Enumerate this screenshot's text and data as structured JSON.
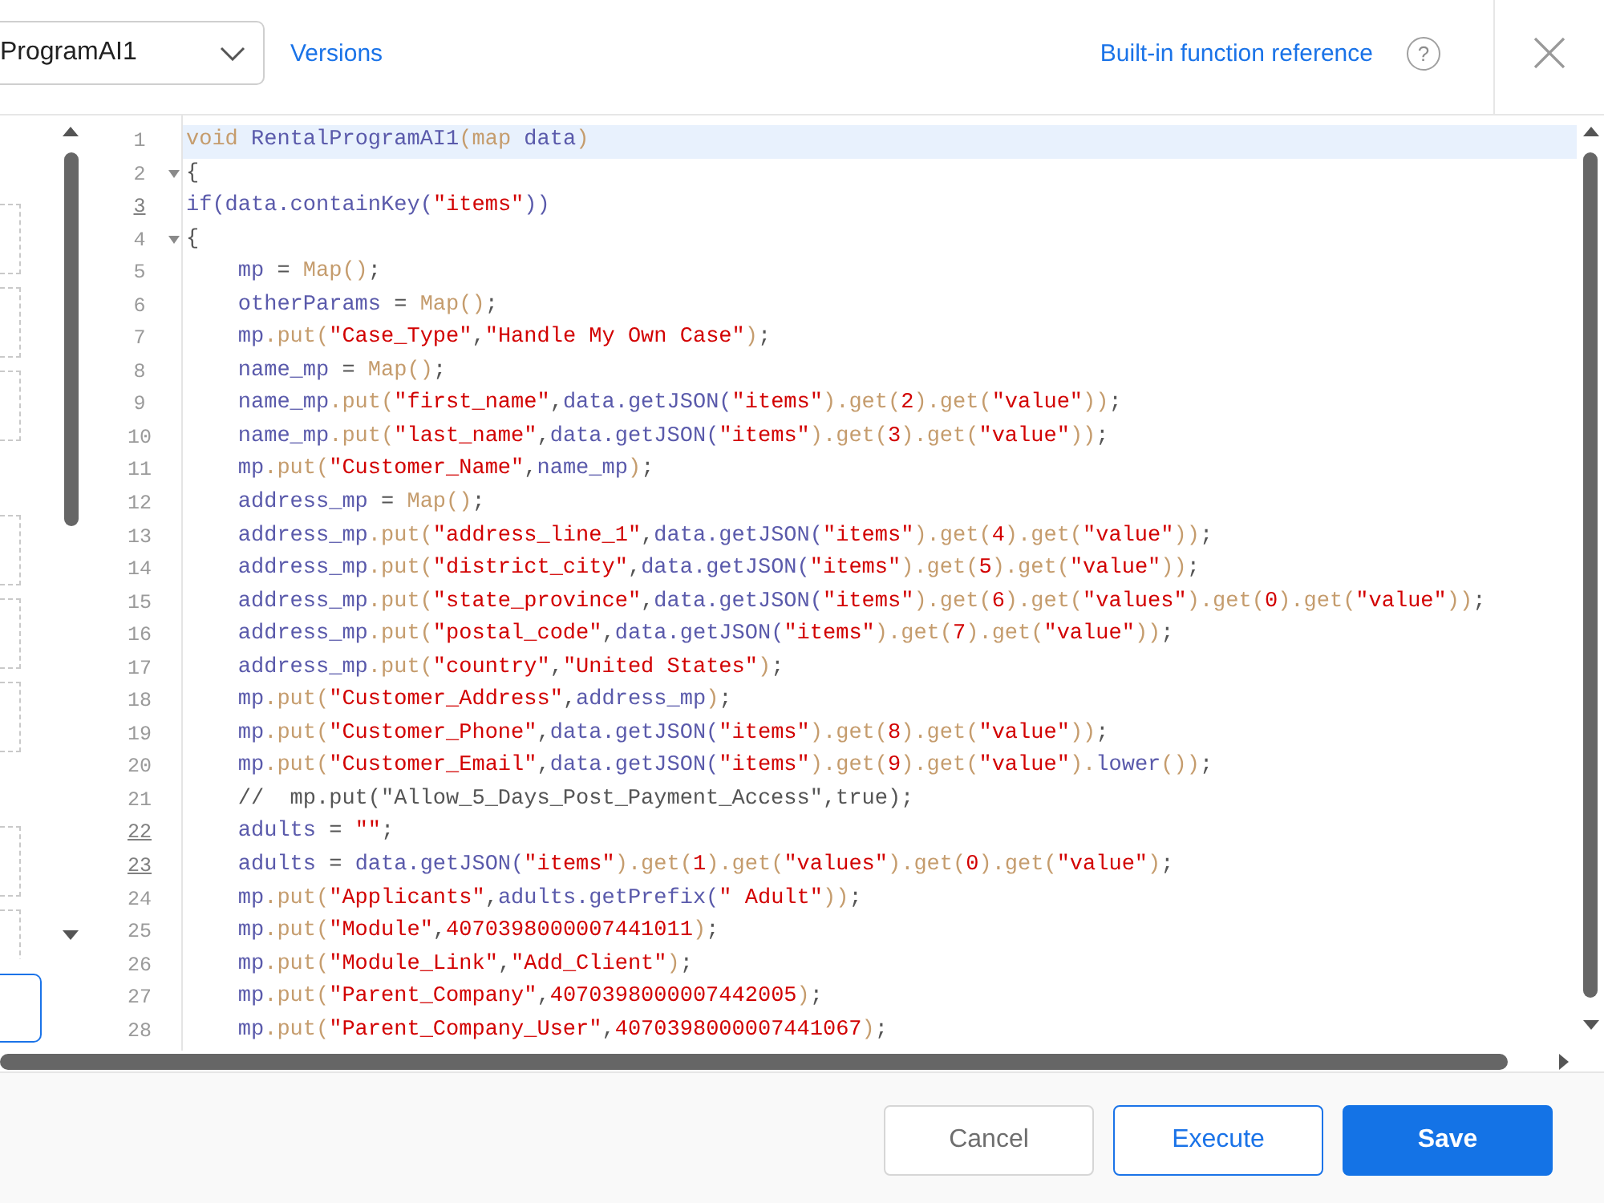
{
  "header": {
    "program_select": {
      "value": "ProgramAI1"
    },
    "versions_link": "Versions",
    "reference_link": "Built-in function reference",
    "help_label": "?"
  },
  "editor": {
    "lines": [
      {
        "number": "1",
        "current": true,
        "marked": false,
        "tokens": [
          {
            "kind": "builtin",
            "text": "void "
          },
          {
            "kind": "name",
            "text": "RentalProgramAI1"
          },
          {
            "kind": "builtin",
            "text": "(map "
          },
          {
            "kind": "name",
            "text": "data"
          },
          {
            "kind": "builtin",
            "text": ")"
          }
        ]
      },
      {
        "number": "2",
        "current": false,
        "marked": false,
        "expanded": true,
        "tokens": [
          {
            "kind": "plain",
            "text": "{"
          }
        ]
      },
      {
        "number": "3",
        "current": false,
        "marked": true,
        "tokens": [
          {
            "kind": "name",
            "text": "if(data.containKey("
          },
          {
            "kind": "literal",
            "text": "\"items\""
          },
          {
            "kind": "name",
            "text": "))"
          }
        ]
      },
      {
        "number": "4",
        "current": false,
        "marked": false,
        "expanded": true,
        "tokens": [
          {
            "kind": "plain",
            "text": "{"
          }
        ],
        "children": [
          {
            "number": "5",
            "current": false,
            "marked": false,
            "tokens": [
              {
                "kind": "name",
                "text": "mp"
              },
              {
                "kind": "plain",
                "text": " = "
              },
              {
                "kind": "builtin",
                "text": "Map()"
              },
              {
                "kind": "plain",
                "text": ";"
              }
            ]
          },
          {
            "number": "6",
            "current": false,
            "marked": false,
            "tokens": [
              {
                "kind": "name",
                "text": "otherParams"
              },
              {
                "kind": "plain",
                "text": " = "
              },
              {
                "kind": "builtin",
                "text": "Map()"
              },
              {
                "kind": "plain",
                "text": ";"
              }
            ]
          },
          {
            "number": "7",
            "current": false,
            "marked": false,
            "tokens": [
              {
                "kind": "name",
                "text": "mp"
              },
              {
                "kind": "builtin",
                "text": ".put("
              },
              {
                "kind": "literal",
                "text": "\"Case_Type\""
              },
              {
                "kind": "plain",
                "text": ","
              },
              {
                "kind": "literal",
                "text": "\"Handle My Own Case\""
              },
              {
                "kind": "builtin",
                "text": ")"
              },
              {
                "kind": "plain",
                "text": ";"
              }
            ]
          },
          {
            "number": "8",
            "current": false,
            "marked": false,
            "tokens": [
              {
                "kind": "name",
                "text": "name_mp"
              },
              {
                "kind": "plain",
                "text": " = "
              },
              {
                "kind": "builtin",
                "text": "Map()"
              },
              {
                "kind": "plain",
                "text": ";"
              }
            ]
          },
          {
            "number": "9",
            "current": false,
            "marked": false,
            "tokens": [
              {
                "kind": "name",
                "text": "name_mp"
              },
              {
                "kind": "builtin",
                "text": ".put("
              },
              {
                "kind": "literal",
                "text": "\"first_name\""
              },
              {
                "kind": "plain",
                "text": ","
              },
              {
                "kind": "name",
                "text": "data.getJSON("
              },
              {
                "kind": "literal",
                "text": "\"items\""
              },
              {
                "kind": "builtin",
                "text": ").get("
              },
              {
                "kind": "literal",
                "text": "2"
              },
              {
                "kind": "builtin",
                "text": ").get("
              },
              {
                "kind": "literal",
                "text": "\"value\""
              },
              {
                "kind": "builtin",
                "text": "))"
              },
              {
                "kind": "plain",
                "text": ";"
              }
            ]
          },
          {
            "number": "10",
            "current": false,
            "marked": false,
            "tokens": [
              {
                "kind": "name",
                "text": "name_mp"
              },
              {
                "kind": "builtin",
                "text": ".put("
              },
              {
                "kind": "literal",
                "text": "\"last_name\""
              },
              {
                "kind": "plain",
                "text": ","
              },
              {
                "kind": "name",
                "text": "data.getJSON("
              },
              {
                "kind": "literal",
                "text": "\"items\""
              },
              {
                "kind": "builtin",
                "text": ").get("
              },
              {
                "kind": "literal",
                "text": "3"
              },
              {
                "kind": "builtin",
                "text": ").get("
              },
              {
                "kind": "literal",
                "text": "\"value\""
              },
              {
                "kind": "builtin",
                "text": "))"
              },
              {
                "kind": "plain",
                "text": ";"
              }
            ]
          },
          {
            "number": "11",
            "current": false,
            "marked": false,
            "tokens": [
              {
                "kind": "name",
                "text": "mp"
              },
              {
                "kind": "builtin",
                "text": ".put("
              },
              {
                "kind": "literal",
                "text": "\"Customer_Name\""
              },
              {
                "kind": "plain",
                "text": ","
              },
              {
                "kind": "name",
                "text": "name_mp"
              },
              {
                "kind": "builtin",
                "text": ")"
              },
              {
                "kind": "plain",
                "text": ";"
              }
            ]
          },
          {
            "number": "12",
            "current": false,
            "marked": false,
            "tokens": [
              {
                "kind": "name",
                "text": "address_mp"
              },
              {
                "kind": "plain",
                "text": " = "
              },
              {
                "kind": "builtin",
                "text": "Map()"
              },
              {
                "kind": "plain",
                "text": ";"
              }
            ]
          },
          {
            "number": "13",
            "current": false,
            "marked": false,
            "tokens": [
              {
                "kind": "name",
                "text": "address_mp"
              },
              {
                "kind": "builtin",
                "text": ".put("
              },
              {
                "kind": "literal",
                "text": "\"address_line_1\""
              },
              {
                "kind": "plain",
                "text": ","
              },
              {
                "kind": "name",
                "text": "data.getJSON("
              },
              {
                "kind": "literal",
                "text": "\"items\""
              },
              {
                "kind": "builtin",
                "text": ").get("
              },
              {
                "kind": "literal",
                "text": "4"
              },
              {
                "kind": "builtin",
                "text": ").get("
              },
              {
                "kind": "literal",
                "text": "\"value\""
              },
              {
                "kind": "builtin",
                "text": "))"
              },
              {
                "kind": "plain",
                "text": ";"
              }
            ]
          },
          {
            "number": "14",
            "current": false,
            "marked": false,
            "tokens": [
              {
                "kind": "name",
                "text": "address_mp"
              },
              {
                "kind": "builtin",
                "text": ".put("
              },
              {
                "kind": "literal",
                "text": "\"district_city\""
              },
              {
                "kind": "plain",
                "text": ","
              },
              {
                "kind": "name",
                "text": "data.getJSON("
              },
              {
                "kind": "literal",
                "text": "\"items\""
              },
              {
                "kind": "builtin",
                "text": ").get("
              },
              {
                "kind": "literal",
                "text": "5"
              },
              {
                "kind": "builtin",
                "text": ").get("
              },
              {
                "kind": "literal",
                "text": "\"value\""
              },
              {
                "kind": "builtin",
                "text": "))"
              },
              {
                "kind": "plain",
                "text": ";"
              }
            ]
          },
          {
            "number": "15",
            "current": false,
            "marked": false,
            "tokens": [
              {
                "kind": "name",
                "text": "address_mp"
              },
              {
                "kind": "builtin",
                "text": ".put("
              },
              {
                "kind": "literal",
                "text": "\"state_province\""
              },
              {
                "kind": "plain",
                "text": ","
              },
              {
                "kind": "name",
                "text": "data.getJSON("
              },
              {
                "kind": "literal",
                "text": "\"items\""
              },
              {
                "kind": "builtin",
                "text": ").get("
              },
              {
                "kind": "literal",
                "text": "6"
              },
              {
                "kind": "builtin",
                "text": ").get("
              },
              {
                "kind": "literal",
                "text": "\"values\""
              },
              {
                "kind": "builtin",
                "text": ").get("
              },
              {
                "kind": "literal",
                "text": "0"
              },
              {
                "kind": "builtin",
                "text": ").get("
              },
              {
                "kind": "literal",
                "text": "\"value\""
              },
              {
                "kind": "builtin",
                "text": "))"
              },
              {
                "kind": "plain",
                "text": ";"
              }
            ]
          },
          {
            "number": "16",
            "current": false,
            "marked": false,
            "tokens": [
              {
                "kind": "name",
                "text": "address_mp"
              },
              {
                "kind": "builtin",
                "text": ".put("
              },
              {
                "kind": "literal",
                "text": "\"postal_code\""
              },
              {
                "kind": "plain",
                "text": ","
              },
              {
                "kind": "name",
                "text": "data.getJSON("
              },
              {
                "kind": "literal",
                "text": "\"items\""
              },
              {
                "kind": "builtin",
                "text": ").get("
              },
              {
                "kind": "literal",
                "text": "7"
              },
              {
                "kind": "builtin",
                "text": ").get("
              },
              {
                "kind": "literal",
                "text": "\"value\""
              },
              {
                "kind": "builtin",
                "text": "))"
              },
              {
                "kind": "plain",
                "text": ";"
              }
            ]
          },
          {
            "number": "17",
            "current": false,
            "marked": false,
            "tokens": [
              {
                "kind": "name",
                "text": "address_mp"
              },
              {
                "kind": "builtin",
                "text": ".put("
              },
              {
                "kind": "literal",
                "text": "\"country\""
              },
              {
                "kind": "plain",
                "text": ","
              },
              {
                "kind": "literal",
                "text": "\"United States\""
              },
              {
                "kind": "builtin",
                "text": ")"
              },
              {
                "kind": "plain",
                "text": ";"
              }
            ]
          },
          {
            "number": "18",
            "current": false,
            "marked": false,
            "tokens": [
              {
                "kind": "name",
                "text": "mp"
              },
              {
                "kind": "builtin",
                "text": ".put("
              },
              {
                "kind": "literal",
                "text": "\"Customer_Address\""
              },
              {
                "kind": "plain",
                "text": ","
              },
              {
                "kind": "name",
                "text": "address_mp"
              },
              {
                "kind": "builtin",
                "text": ")"
              },
              {
                "kind": "plain",
                "text": ";"
              }
            ]
          },
          {
            "number": "19",
            "current": false,
            "marked": false,
            "tokens": [
              {
                "kind": "name",
                "text": "mp"
              },
              {
                "kind": "builtin",
                "text": ".put("
              },
              {
                "kind": "literal",
                "text": "\"Customer_Phone\""
              },
              {
                "kind": "plain",
                "text": ","
              },
              {
                "kind": "name",
                "text": "data.getJSON("
              },
              {
                "kind": "literal",
                "text": "\"items\""
              },
              {
                "kind": "builtin",
                "text": ").get("
              },
              {
                "kind": "literal",
                "text": "8"
              },
              {
                "kind": "builtin",
                "text": ").get("
              },
              {
                "kind": "literal",
                "text": "\"value\""
              },
              {
                "kind": "builtin",
                "text": "))"
              },
              {
                "kind": "plain",
                "text": ";"
              }
            ]
          },
          {
            "number": "20",
            "current": false,
            "marked": false,
            "tokens": [
              {
                "kind": "name",
                "text": "mp"
              },
              {
                "kind": "builtin",
                "text": ".put("
              },
              {
                "kind": "literal",
                "text": "\"Customer_Email\""
              },
              {
                "kind": "plain",
                "text": ","
              },
              {
                "kind": "name",
                "text": "data.getJSON("
              },
              {
                "kind": "literal",
                "text": "\"items\""
              },
              {
                "kind": "builtin",
                "text": ").get("
              },
              {
                "kind": "literal",
                "text": "9"
              },
              {
                "kind": "builtin",
                "text": ").get("
              },
              {
                "kind": "literal",
                "text": "\"value\""
              },
              {
                "kind": "builtin",
                "text": ")."
              },
              {
                "kind": "name",
                "text": "lower"
              },
              {
                "kind": "builtin",
                "text": "())"
              },
              {
                "kind": "plain",
                "text": ";"
              }
            ]
          },
          {
            "number": "21",
            "current": false,
            "marked": false,
            "tokens": [
              {
                "kind": "comment",
                "text": "//  mp.put(\"Allow_5_Days_Post_Payment_Access\",true);"
              }
            ]
          },
          {
            "number": "22",
            "current": false,
            "marked": true,
            "tokens": [
              {
                "kind": "name",
                "text": "adults"
              },
              {
                "kind": "plain",
                "text": " = "
              },
              {
                "kind": "literal",
                "text": "\"\""
              },
              {
                "kind": "plain",
                "text": ";"
              }
            ]
          },
          {
            "number": "23",
            "current": false,
            "marked": true,
            "tokens": [
              {
                "kind": "name",
                "text": "adults"
              },
              {
                "kind": "plain",
                "text": " = "
              },
              {
                "kind": "name",
                "text": "data.getJSON("
              },
              {
                "kind": "literal",
                "text": "\"items\""
              },
              {
                "kind": "builtin",
                "text": ").get("
              },
              {
                "kind": "literal",
                "text": "1"
              },
              {
                "kind": "builtin",
                "text": ").get("
              },
              {
                "kind": "literal",
                "text": "\"values\""
              },
              {
                "kind": "builtin",
                "text": ").get("
              },
              {
                "kind": "literal",
                "text": "0"
              },
              {
                "kind": "builtin",
                "text": ").get("
              },
              {
                "kind": "literal",
                "text": "\"value\""
              },
              {
                "kind": "builtin",
                "text": ")"
              },
              {
                "kind": "plain",
                "text": ";"
              }
            ]
          },
          {
            "number": "24",
            "current": false,
            "marked": false,
            "tokens": [
              {
                "kind": "name",
                "text": "mp"
              },
              {
                "kind": "builtin",
                "text": ".put("
              },
              {
                "kind": "literal",
                "text": "\"Applicants\""
              },
              {
                "kind": "plain",
                "text": ","
              },
              {
                "kind": "name",
                "text": "adults.getPrefix("
              },
              {
                "kind": "literal",
                "text": "\" Adult\""
              },
              {
                "kind": "builtin",
                "text": "))"
              },
              {
                "kind": "plain",
                "text": ";"
              }
            ]
          },
          {
            "number": "25",
            "current": false,
            "marked": false,
            "tokens": [
              {
                "kind": "name",
                "text": "mp"
              },
              {
                "kind": "builtin",
                "text": ".put("
              },
              {
                "kind": "literal",
                "text": "\"Module\""
              },
              {
                "kind": "plain",
                "text": ","
              },
              {
                "kind": "literal",
                "text": "4070398000007441011"
              },
              {
                "kind": "builtin",
                "text": ")"
              },
              {
                "kind": "plain",
                "text": ";"
              }
            ]
          },
          {
            "number": "26",
            "current": false,
            "marked": false,
            "tokens": [
              {
                "kind": "name",
                "text": "mp"
              },
              {
                "kind": "builtin",
                "text": ".put("
              },
              {
                "kind": "literal",
                "text": "\"Module_Link\""
              },
              {
                "kind": "plain",
                "text": ","
              },
              {
                "kind": "literal",
                "text": "\"Add_Client\""
              },
              {
                "kind": "builtin",
                "text": ")"
              },
              {
                "kind": "plain",
                "text": ";"
              }
            ]
          },
          {
            "number": "27",
            "current": false,
            "marked": false,
            "tokens": [
              {
                "kind": "name",
                "text": "mp"
              },
              {
                "kind": "builtin",
                "text": ".put("
              },
              {
                "kind": "literal",
                "text": "\"Parent_Company\""
              },
              {
                "kind": "plain",
                "text": ","
              },
              {
                "kind": "literal",
                "text": "4070398000007442005"
              },
              {
                "kind": "builtin",
                "text": ")"
              },
              {
                "kind": "plain",
                "text": ";"
              }
            ]
          },
          {
            "number": "28",
            "current": false,
            "marked": false,
            "tokens": [
              {
                "kind": "name",
                "text": "mp"
              },
              {
                "kind": "builtin",
                "text": ".put("
              },
              {
                "kind": "literal",
                "text": "\"Parent_Company_User\""
              },
              {
                "kind": "plain",
                "text": ","
              },
              {
                "kind": "literal",
                "text": "4070398000007441067"
              },
              {
                "kind": "builtin",
                "text": ")"
              },
              {
                "kind": "plain",
                "text": ";"
              }
            ]
          }
        ]
      }
    ]
  },
  "footer": {
    "buttons": [
      {
        "label": "Cancel",
        "kind": "secondary"
      },
      {
        "label": "Execute",
        "kind": "outline"
      },
      {
        "label": "Save",
        "kind": "primary"
      }
    ]
  }
}
